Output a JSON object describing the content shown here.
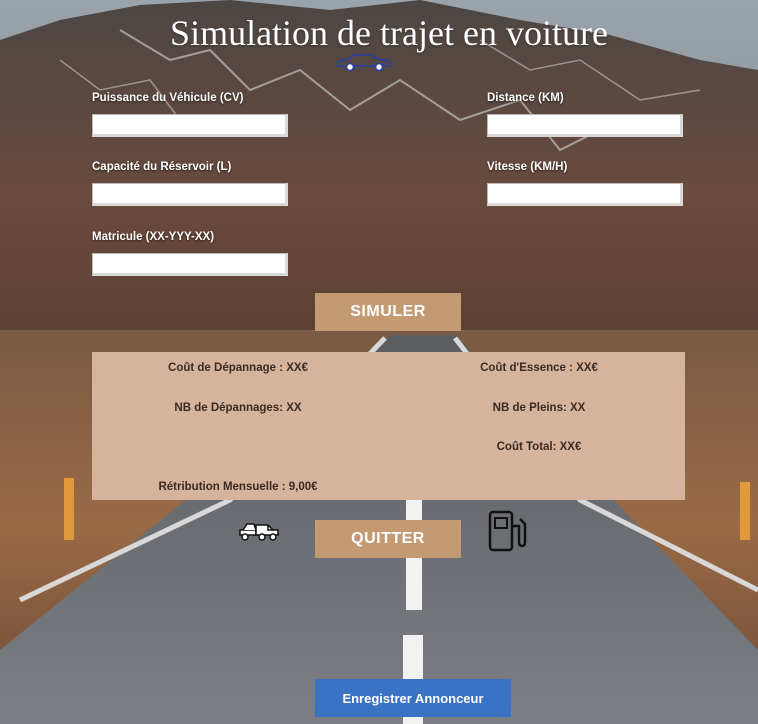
{
  "page": {
    "title": "Simulation de trajet en voiture"
  },
  "form": {
    "puissance": {
      "label": "Puissance du Véhicule (CV)",
      "value": ""
    },
    "distance": {
      "label": "Distance (KM)",
      "value": ""
    },
    "capacite": {
      "label": "Capacité du Réservoir (L)",
      "value": ""
    },
    "vitesse": {
      "label": "Vitesse (KM/H)",
      "value": ""
    },
    "matricule": {
      "label": "Matricule (XX-YYY-XX)",
      "value": ""
    }
  },
  "buttons": {
    "simuler": "SIMULER",
    "quitter": "QUITTER",
    "enregistrer": "Enregistrer Annonceur"
  },
  "results": {
    "cout_depannage": "Coût de Dépannage : XX€",
    "cout_essence": "Coût d'Essence : XX€",
    "nb_depannages": "NB de Dépannages: XX",
    "nb_pleins": "NB de Pleins: XX",
    "cout_total": "Coût Total: XX€",
    "retribution": "Rétribution Mensuelle : 9,00€"
  },
  "icons": {
    "car": "car-icon",
    "tow_truck": "tow-truck-icon",
    "fuel_pump": "fuel-pump-icon"
  },
  "colors": {
    "button": "#c49a73",
    "results_panel": "#d6b39d",
    "register_button": "#3a73c4",
    "car_icon": "#2b3fa8"
  }
}
